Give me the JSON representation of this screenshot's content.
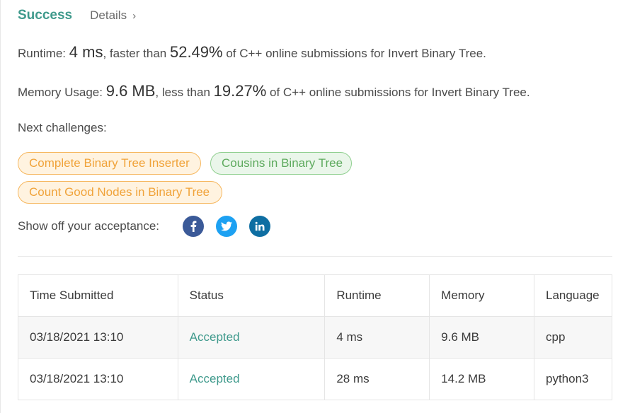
{
  "header": {
    "status": "Success",
    "details_label": "Details",
    "details_chevron": "›"
  },
  "runtime": {
    "label": "Runtime:",
    "value": "4 ms",
    "mid": ", faster than",
    "percent": "52.49%",
    "suffix": "of C++ online submissions for Invert Binary Tree."
  },
  "memory": {
    "label": "Memory Usage:",
    "value": "9.6 MB",
    "mid": ", less than",
    "percent": "19.27%",
    "suffix": "of C++ online submissions for Invert Binary Tree."
  },
  "next_challenges": {
    "label": "Next challenges:",
    "items": [
      {
        "title": "Complete Binary Tree Inserter",
        "difficulty_color": "#f0a33a"
      },
      {
        "title": "Cousins in Binary Tree",
        "difficulty_color": "#5eaa5e"
      },
      {
        "title": "Count Good Nodes in Binary Tree",
        "difficulty_color": "#f0a33a"
      }
    ]
  },
  "share": {
    "label": "Show off your acceptance:",
    "icons": [
      "facebook-icon",
      "twitter-icon",
      "linkedin-icon"
    ]
  },
  "colors": {
    "accent": "#3f9a8c",
    "facebook": "#3b5a98",
    "twitter": "#1da1f2",
    "linkedin": "#0e6ea2"
  },
  "submissions": {
    "columns": [
      "Time Submitted",
      "Status",
      "Runtime",
      "Memory",
      "Language"
    ],
    "rows": [
      {
        "time": "03/18/2021 13:10",
        "status": "Accepted",
        "runtime": "4 ms",
        "memory": "9.6 MB",
        "language": "cpp"
      },
      {
        "time": "03/18/2021 13:10",
        "status": "Accepted",
        "runtime": "28 ms",
        "memory": "14.2 MB",
        "language": "python3"
      }
    ]
  }
}
